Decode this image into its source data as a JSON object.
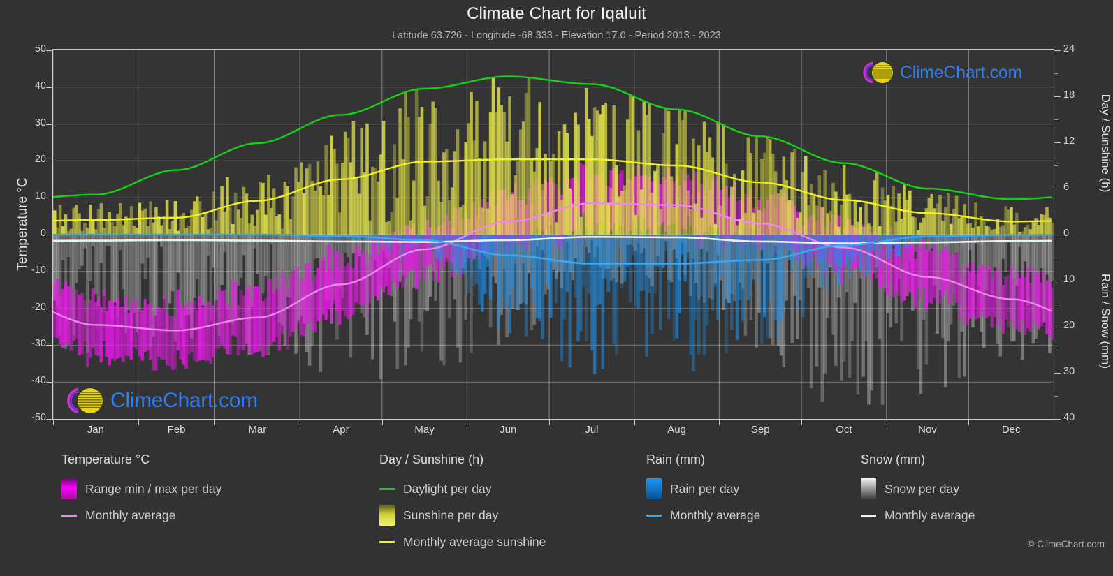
{
  "header": {
    "title": "Climate Chart for Iqaluit",
    "subtitle": "Latitude 63.726 - Longitude -68.333 - Elevation 17.0 - Period 2013 - 2023"
  },
  "branding": {
    "logo_text": "ClimeChart.com",
    "logo_name": "climechart-logo",
    "copyright": "© ClimeChart.com",
    "brand_blue": "#2f7ff0",
    "brand_magenta": "#cc33cc",
    "brand_yellow": "#e0d020"
  },
  "axes": {
    "left_title": "Temperature °C",
    "right_title_top": "Day / Sunshine (h)",
    "right_title_bottom": "Rain / Snow (mm)",
    "left_ticks": [
      50,
      40,
      30,
      20,
      10,
      0,
      -10,
      -20,
      -30,
      -40,
      -50
    ],
    "right_ticks_top": [
      24,
      18,
      12,
      6,
      0
    ],
    "right_ticks_bottom": [
      0,
      10,
      20,
      30,
      40
    ],
    "x_ticks": [
      "Jan",
      "Feb",
      "Mar",
      "Apr",
      "May",
      "Jun",
      "Jul",
      "Aug",
      "Sep",
      "Oct",
      "Nov",
      "Dec"
    ]
  },
  "legend": {
    "groups": [
      {
        "title": "Temperature °C",
        "name": "legend-temperature",
        "items": [
          {
            "label": "Range min / max per day",
            "type": "swatch",
            "color": "#e619e6",
            "name": "legend-temp-range"
          },
          {
            "label": "Monthly average",
            "type": "line",
            "color": "#ee88ee",
            "name": "legend-temp-average"
          }
        ]
      },
      {
        "title": "Day / Sunshine (h)",
        "name": "legend-day-sunshine",
        "items": [
          {
            "label": "Daylight per day",
            "type": "line",
            "color": "#16d216",
            "name": "legend-daylight"
          },
          {
            "label": "Sunshine per day",
            "type": "swatch",
            "color": "#e8e84a",
            "name": "legend-sunshine"
          },
          {
            "label": "Monthly average sunshine",
            "type": "line",
            "color": "#f0f024",
            "name": "legend-sunshine-average"
          }
        ]
      },
      {
        "title": "Rain (mm)",
        "name": "legend-rain",
        "items": [
          {
            "label": "Rain per day",
            "type": "swatch",
            "color": "#1d8fe8",
            "name": "legend-rain-day"
          },
          {
            "label": "Monthly average",
            "type": "line",
            "color": "#3aa8f0",
            "name": "legend-rain-average"
          }
        ]
      },
      {
        "title": "Snow (mm)",
        "name": "legend-snow",
        "items": [
          {
            "label": "Snow per day",
            "type": "swatch",
            "color": "#d8d8d8",
            "name": "legend-snow-day"
          },
          {
            "label": "Monthly average",
            "type": "line",
            "color": "#f0f0f0",
            "name": "legend-snow-average"
          }
        ]
      }
    ]
  },
  "chart_data": {
    "type": "line",
    "title": "Climate Chart for Iqaluit",
    "subtitle": "Latitude 63.726 - Longitude -68.333 - Elevation 17.0 - Period 2013 - 2023",
    "xlabel": "",
    "ylabel": "Temperature °C",
    "ylim": [
      -50,
      50
    ],
    "y2lim_day_sunshine": [
      0,
      24
    ],
    "y2lim_rain_snow": [
      0,
      40
    ],
    "grid": true,
    "legend_position": "below",
    "categories": [
      "Jan",
      "Feb",
      "Mar",
      "Apr",
      "May",
      "Jun",
      "Jul",
      "Aug",
      "Sep",
      "Oct",
      "Nov",
      "Dec"
    ],
    "series": [
      {
        "name": "Monthly average temperature (°C)",
        "unit": "°C",
        "axis": "left",
        "color": "#ee88ee",
        "values": [
          -24.5,
          -26.0,
          -22.5,
          -13.5,
          -4.0,
          3.5,
          8.5,
          8.0,
          3.0,
          -3.5,
          -11.5,
          -17.5
        ]
      },
      {
        "name": "Daily temperature max (°C)",
        "unit": "°C",
        "axis": "left",
        "color": "#e619e6",
        "values": [
          -19.0,
          -20.5,
          -16.5,
          -8.0,
          0.5,
          9.0,
          14.5,
          13.5,
          7.5,
          0.5,
          -6.5,
          -12.5
        ]
      },
      {
        "name": "Daily temperature min (°C)",
        "unit": "°C",
        "axis": "left",
        "color": "#e619e6",
        "values": [
          -30.5,
          -32.0,
          -29.0,
          -19.5,
          -8.5,
          -1.0,
          3.5,
          3.5,
          -0.5,
          -7.5,
          -16.5,
          -23.0
        ]
      },
      {
        "name": "Daylight per day (h)",
        "unit": "h",
        "axis": "right_top",
        "color": "#16d216",
        "values": [
          5.2,
          8.4,
          11.9,
          15.6,
          19.0,
          20.6,
          19.6,
          16.3,
          12.8,
          9.3,
          6.0,
          4.6
        ]
      },
      {
        "name": "Monthly average sunshine (h)",
        "unit": "h",
        "axis": "right_top",
        "color": "#f0f024",
        "values": [
          1.9,
          2.2,
          4.4,
          7.2,
          9.5,
          9.8,
          9.8,
          9.0,
          6.8,
          4.5,
          2.8,
          1.7
        ]
      },
      {
        "name": "Monthly average rain (mm)",
        "unit": "mm",
        "axis": "right_bottom",
        "color": "#3aa8f0",
        "values": [
          0.0,
          0.0,
          0.0,
          0.3,
          1.2,
          4.5,
          6.3,
          6.3,
          5.5,
          2.3,
          0.4,
          0.1
        ]
      },
      {
        "name": "Monthly average snow (mm)",
        "unit": "mm",
        "axis": "right_bottom",
        "color": "#f0f0f0",
        "values": [
          1.3,
          1.2,
          1.3,
          1.5,
          1.6,
          1.2,
          0.5,
          0.6,
          1.5,
          1.9,
          1.7,
          1.4
        ]
      }
    ]
  }
}
